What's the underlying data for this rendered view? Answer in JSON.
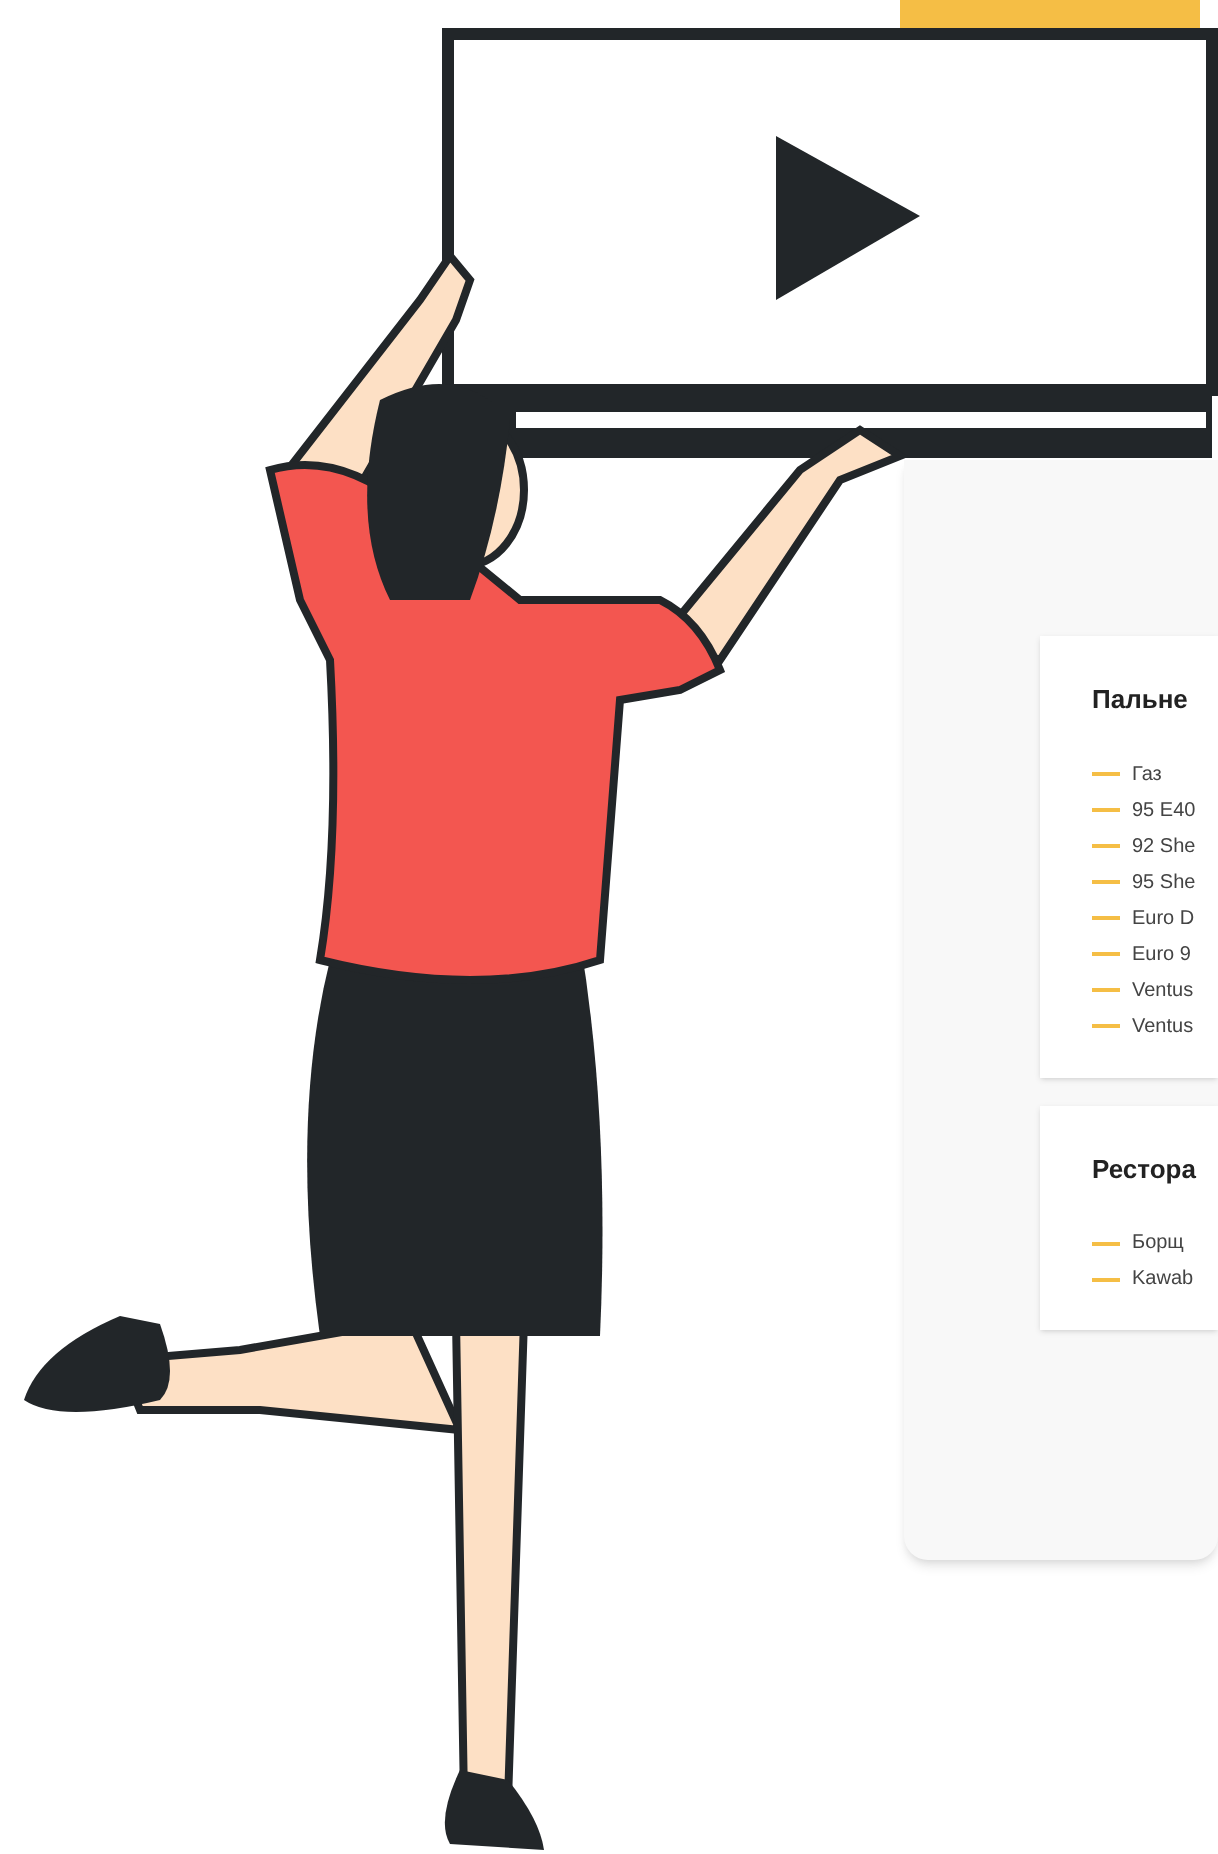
{
  "cards": [
    {
      "title": "Пальне",
      "items": [
        "Газ",
        "95 E40",
        "92 She",
        "95 She",
        "Euro D",
        "Euro 9",
        "Ventus",
        "Ventus"
      ]
    },
    {
      "title": "Рестора",
      "items": [
        "Борщ",
        "Kawab"
      ]
    }
  ]
}
